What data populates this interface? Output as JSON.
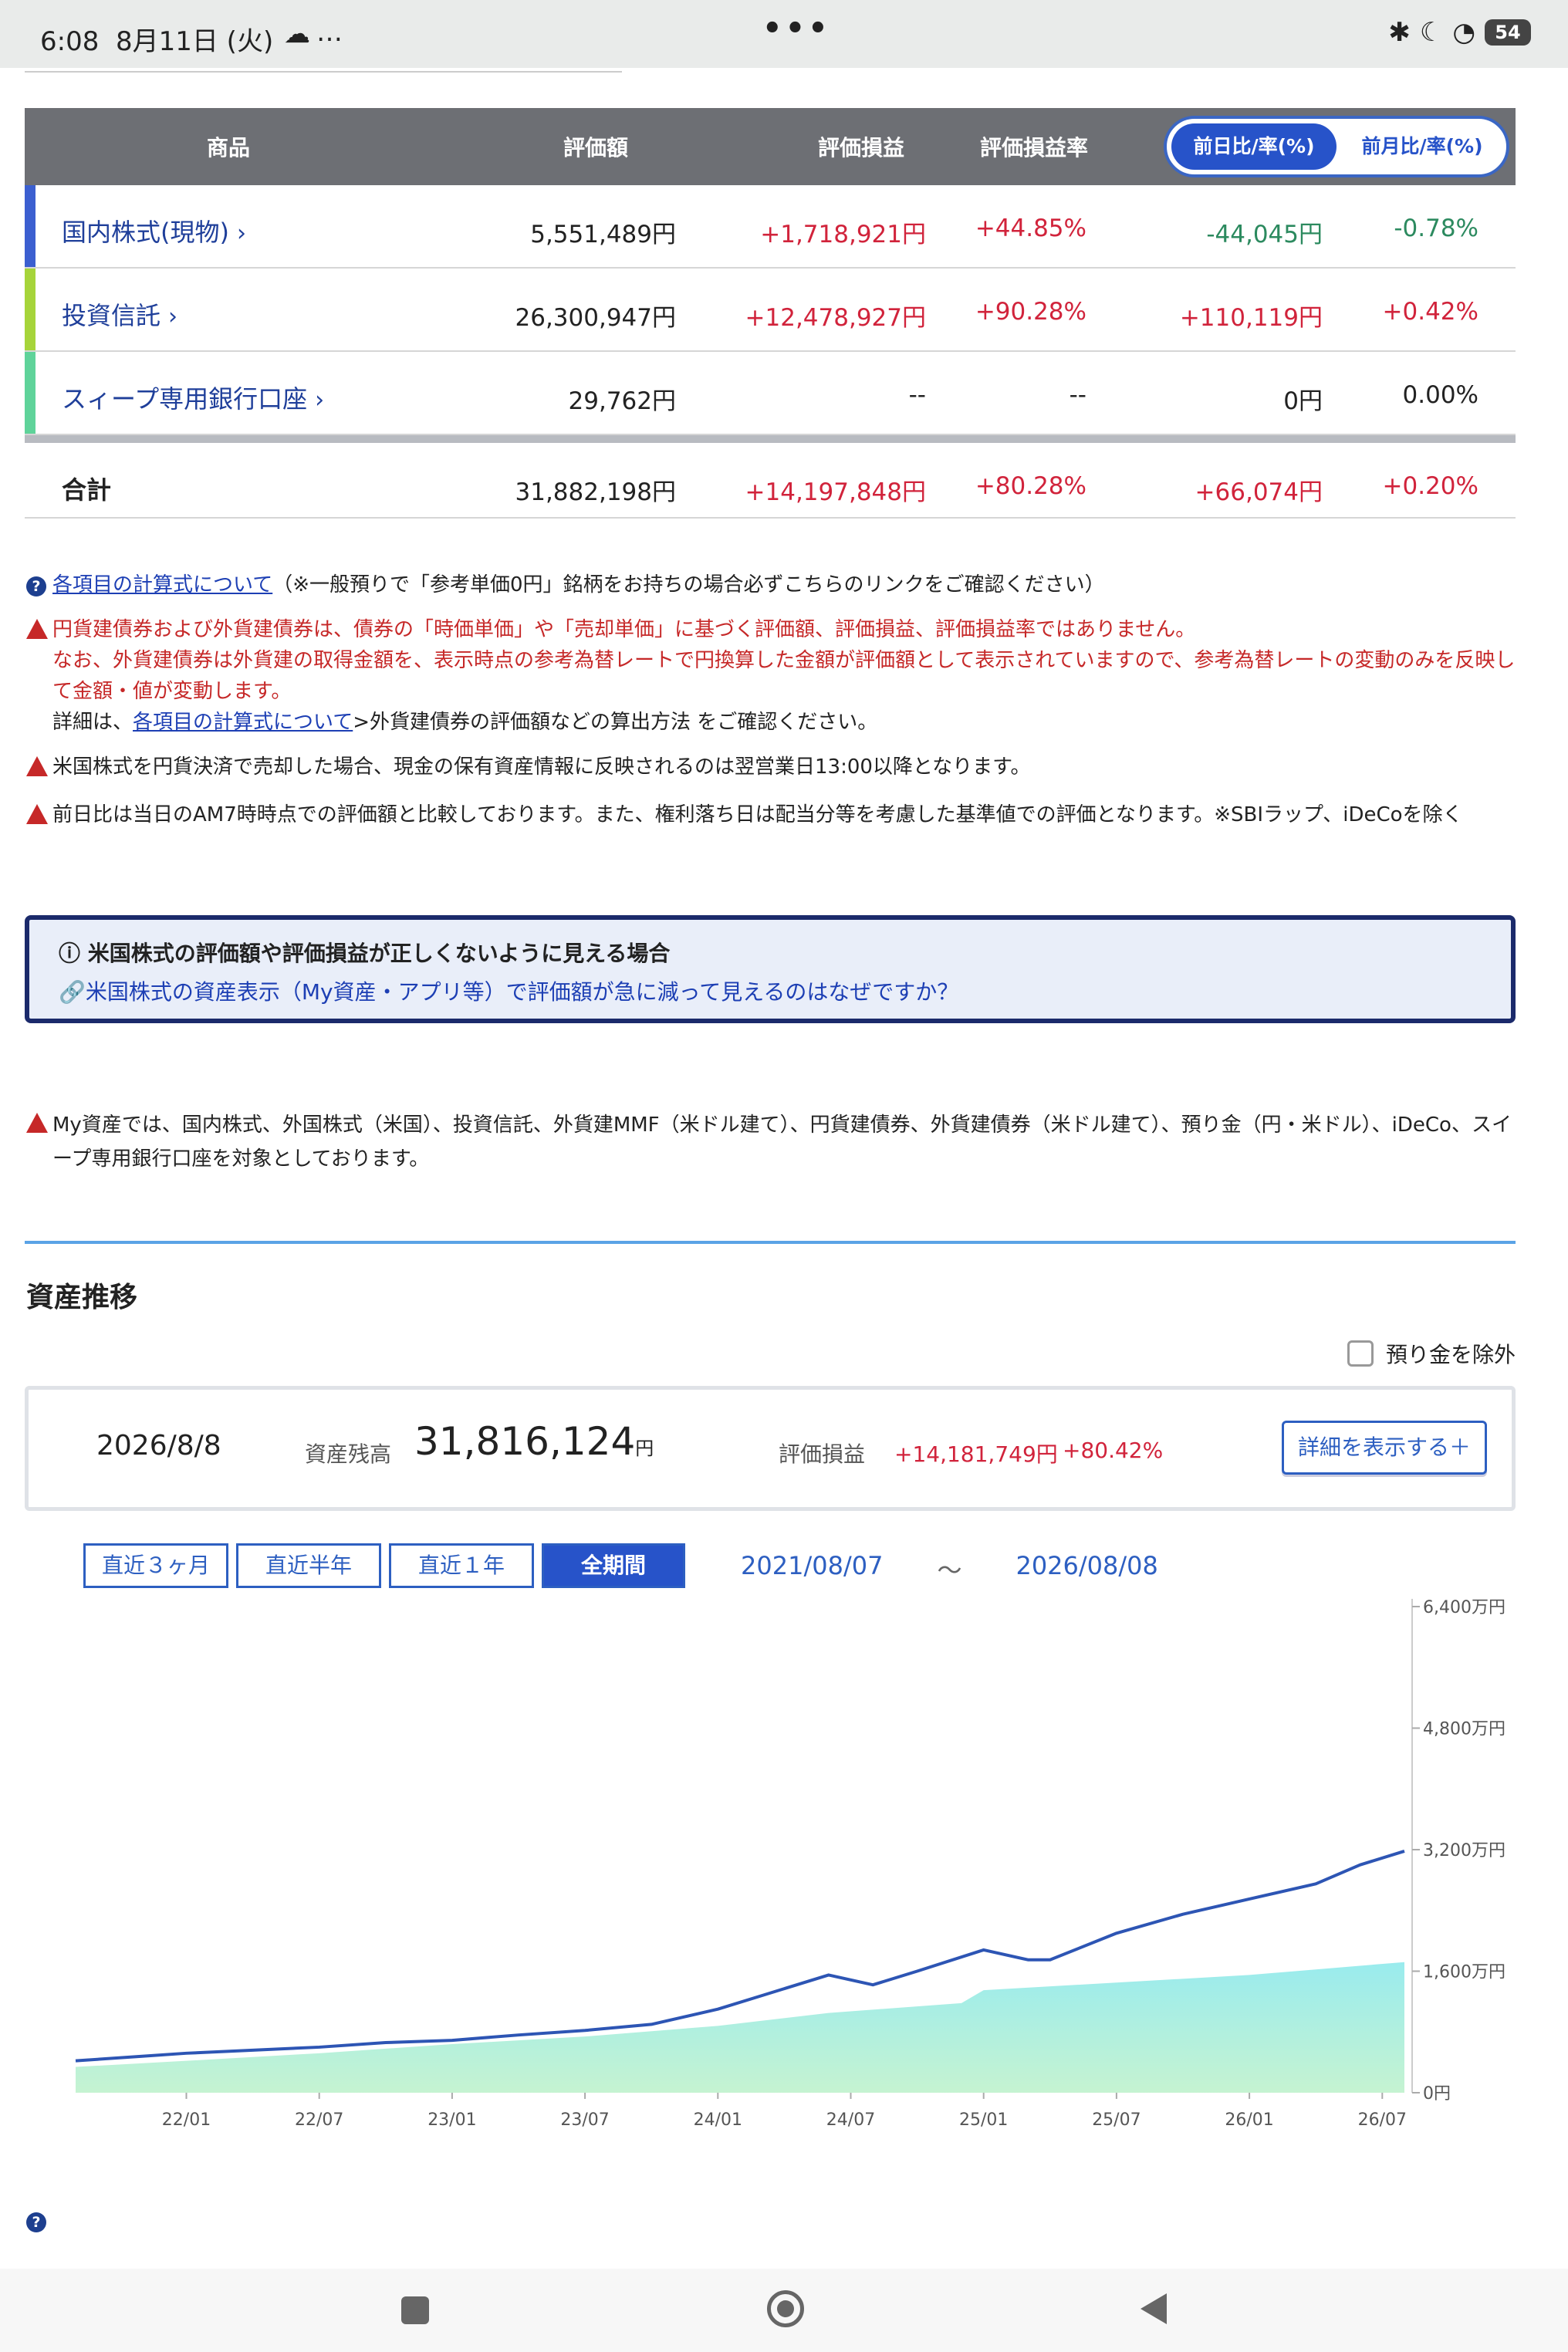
{
  "status_bar": {
    "time": "6:08",
    "date": "8月11日 (火)",
    "battery": "54"
  },
  "holdings_table": {
    "headers": [
      "商品",
      "評価額",
      "評価損益",
      "評価損益率"
    ],
    "toggle": {
      "active": "前日比/率(%)",
      "inactive": "前月比/率(%)"
    },
    "rows": [
      {
        "name": "国内株式(現物)",
        "value": "5,551,489円",
        "gain": "+1,718,921円",
        "rate": "+44.85%",
        "day_change": "-44,045円",
        "day_rate": "-0.78%",
        "color": "#3b5fd0"
      },
      {
        "name": "投資信託",
        "value": "26,300,947円",
        "gain": "+12,478,927円",
        "rate": "+90.28%",
        "day_change": "+110,119円",
        "day_rate": "+0.42%",
        "color": "#a6d43a"
      },
      {
        "name": "スィープ専用銀行口座",
        "value": "29,762円",
        "gain": "--",
        "rate": "--",
        "day_change": "0円",
        "day_rate": "0.00%",
        "color": "#5fd39a"
      }
    ],
    "total": {
      "name": "合計",
      "value": "31,882,198円",
      "gain": "+14,197,848円",
      "rate": "+80.28%",
      "day_change": "+66,074円",
      "day_rate": "+0.20%"
    }
  },
  "notes": {
    "calc_link": "各項目の計算式について",
    "calc_suffix": "（※一般預りで「参考単価0円」銘柄をお持ちの場合必ずこちらのリンクをご確認ください）",
    "bond_line1": "円貨建債券および外貨建債券は、債券の「時価単価」や「売却単価」に基づく評価額、評価損益、評価損益率ではありません。",
    "bond_line2": "なお、外貨建債券は外貨建の取得金額を、表示時点の参考為替レートで円換算した金額が評価額として表示されていますので、参考為替レートの変動のみを反映して金額・値が変動します。",
    "bond_detail_prefix": "詳細は、",
    "bond_detail_link": "各項目の計算式について",
    "bond_detail_suffix": ">外貨建債券の評価額などの算出方法 をご確認ください。",
    "us_stock": "米国株式を円貨決済で売却した場合、現金の保有資産情報に反映されるのは翌営業日13:00以降となります。",
    "prev_day": "前日比は当日のAM7時時点での評価額と比較しております。また、権利落ち日は配当分等を考慮した基準値での評価となります。※SBIラップ、iDeCoを除く"
  },
  "info_box": {
    "title": "米国株式の評価額や評価損益が正しくないように見える場合",
    "link": "🔗米国株式の資産表示（My資産・アプリ等）で評価額が急に減って見えるのはなぜですか？"
  },
  "my_assets_note": "My資産では、国内株式、外国株式（米国）、投資信託、外貨建MMF（米ドル建て）、円貨建債券、外貨建債券（米ドル建て）、預り金（円・米ドル）、iDeCo、スイープ専用銀行口座を対象としております。",
  "asset_section": {
    "title": "資産推移",
    "exclude_label": "預り金を除外",
    "summary": {
      "date": "2026/8/8",
      "balance_label": "資産残高",
      "balance": "31,816,124",
      "yen": "円",
      "gain_label": "評価損益",
      "gain": "+14,181,749円",
      "gain_rate": "+80.42%",
      "detail_button": "詳細を表示する＋"
    },
    "ranges": [
      "直近３ヶ月",
      "直近半年",
      "直近１年",
      "全期間"
    ],
    "active_range": "全期間",
    "date_from": "2021/08/07",
    "date_sep": "〜",
    "date_to": "2026/08/08"
  },
  "chart_data": {
    "type": "line",
    "x_ticks": [
      "22/01",
      "22/07",
      "23/01",
      "23/07",
      "24/01",
      "24/07",
      "25/01",
      "25/07",
      "26/01",
      "26/07"
    ],
    "y_ticks": [
      "0円",
      "1,600万円",
      "3,200万円",
      "4,800万円",
      "6,400万円"
    ],
    "ylim": [
      0,
      64000000
    ],
    "series": [
      {
        "name": "",
        "kind": "line",
        "color": "#2d55b4",
        "x": [
          "2021-08",
          "2021-11",
          "2022-01",
          "2022-04",
          "2022-07",
          "2022-10",
          "2023-01",
          "2023-04",
          "2023-07",
          "2023-10",
          "2024-01",
          "2024-03",
          "2024-06",
          "2024-08",
          "2024-10",
          "2025-01",
          "2025-03",
          "2025-04",
          "2025-07",
          "2025-10",
          "2026-01",
          "2026-04",
          "2026-06",
          "2026-08"
        ],
        "values": [
          4200000,
          4800000,
          5200000,
          5600000,
          6000000,
          6600000,
          6900000,
          7600000,
          8200000,
          9000000,
          11000000,
          12800000,
          15500000,
          14200000,
          16000000,
          18800000,
          17500000,
          17500000,
          21000000,
          23500000,
          25500000,
          27500000,
          30000000,
          31800000
        ]
      },
      {
        "name": "",
        "kind": "area",
        "color": "#8ee9ec",
        "x": [
          "2021-08",
          "2022-01",
          "2022-07",
          "2023-01",
          "2023-07",
          "2024-01",
          "2024-06",
          "2024-12",
          "2025-01",
          "2025-07",
          "2026-01",
          "2026-08"
        ],
        "values": [
          3400000,
          4200000,
          5200000,
          6400000,
          7400000,
          8800000,
          10500000,
          11800000,
          13500000,
          14500000,
          15500000,
          17200000
        ]
      }
    ]
  }
}
